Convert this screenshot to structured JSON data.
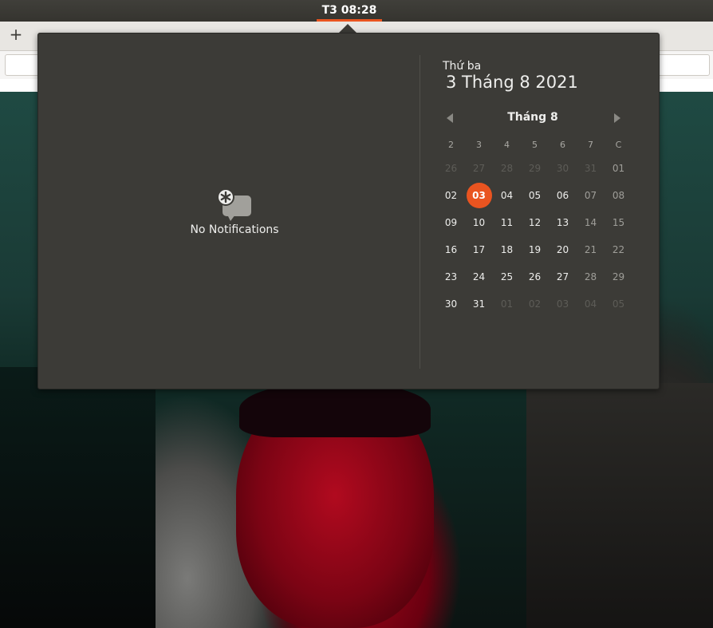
{
  "topbar": {
    "clock": "T3 08:28",
    "accent_color": "#e95420"
  },
  "browser": {
    "new_tab_label": "+"
  },
  "notifications": {
    "icon": "notification-bubble-icon",
    "empty_text": "No Notifications"
  },
  "calendar": {
    "weekday": "Thứ ba",
    "full_date": "3 Tháng 8 2021",
    "month_label": "Tháng 8",
    "prev_icon": "chevron-left-icon",
    "next_icon": "chevron-right-icon",
    "day_headers": [
      "2",
      "3",
      "4",
      "5",
      "6",
      "7",
      "C"
    ],
    "weeks": [
      [
        {
          "d": "26",
          "other": true
        },
        {
          "d": "27",
          "other": true
        },
        {
          "d": "28",
          "other": true
        },
        {
          "d": "29",
          "other": true
        },
        {
          "d": "30",
          "other": true
        },
        {
          "d": "31",
          "other": true
        },
        {
          "d": "01"
        }
      ],
      [
        {
          "d": "02"
        },
        {
          "d": "03",
          "today": true
        },
        {
          "d": "04"
        },
        {
          "d": "05"
        },
        {
          "d": "06"
        },
        {
          "d": "07"
        },
        {
          "d": "08"
        }
      ],
      [
        {
          "d": "09"
        },
        {
          "d": "10"
        },
        {
          "d": "11"
        },
        {
          "d": "12"
        },
        {
          "d": "13"
        },
        {
          "d": "14"
        },
        {
          "d": "15"
        }
      ],
      [
        {
          "d": "16"
        },
        {
          "d": "17"
        },
        {
          "d": "18"
        },
        {
          "d": "19"
        },
        {
          "d": "20"
        },
        {
          "d": "21"
        },
        {
          "d": "22"
        }
      ],
      [
        {
          "d": "23"
        },
        {
          "d": "24"
        },
        {
          "d": "25"
        },
        {
          "d": "26"
        },
        {
          "d": "27"
        },
        {
          "d": "28"
        },
        {
          "d": "29"
        }
      ],
      [
        {
          "d": "30"
        },
        {
          "d": "31"
        },
        {
          "d": "01",
          "other": true
        },
        {
          "d": "02",
          "other": true
        },
        {
          "d": "03",
          "other": true
        },
        {
          "d": "04",
          "other": true
        },
        {
          "d": "05",
          "other": true
        }
      ]
    ]
  }
}
